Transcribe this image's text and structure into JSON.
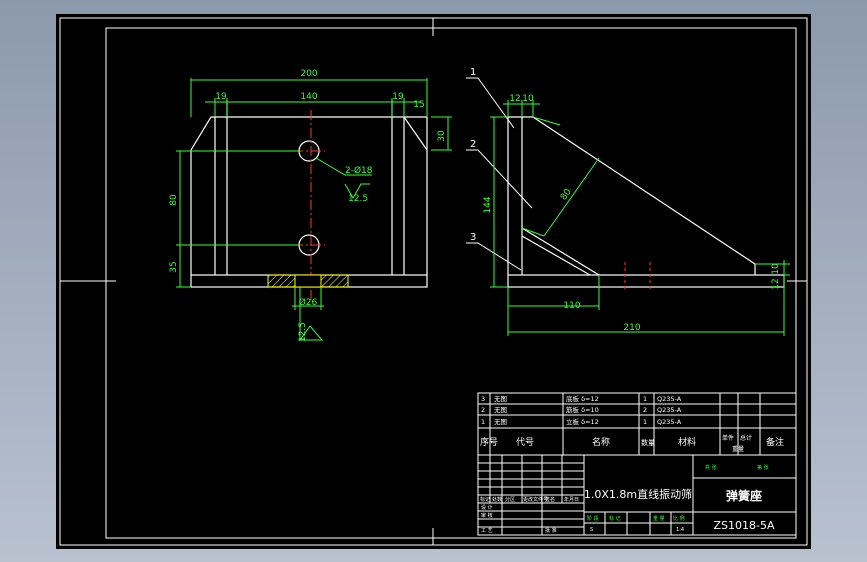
{
  "colors": {
    "background_gradient_top": "#8c99ad",
    "background_gradient_bottom": "#b9c1cf",
    "paper": "#000000",
    "frame": "#ffffff",
    "dimension": "#33ff33",
    "centerline": "#ff3333",
    "hatch": "#ffff00",
    "table_text": "#ffffff",
    "table_highlight": "#33ff33"
  },
  "front_view": {
    "dims": {
      "overall_width": "200",
      "left_flange": "19",
      "middle_span": "140",
      "right_flange": "19",
      "chamfer": "15",
      "top_height": "30",
      "hole_spacing": "80",
      "bottom_height": "35",
      "hole_callout": "2-Ø18",
      "roughness": "12.5",
      "bore": "Ø26",
      "bottom_roughness": "12.5"
    }
  },
  "side_view": {
    "balloons": [
      "1",
      "2",
      "3"
    ],
    "dims": {
      "top_a": "12",
      "top_b": "10",
      "height": "144",
      "rib_width": "80",
      "base_length": "110",
      "total_length": "210",
      "right_a": "12",
      "right_b": "10"
    }
  },
  "title_block": {
    "parts": [
      {
        "no": "3",
        "code": "无图",
        "name": "底板 δ=12",
        "qty": "1",
        "material": "Q235-A"
      },
      {
        "no": "2",
        "code": "无图",
        "name": "筋板 δ=10",
        "qty": "2",
        "material": "Q235-A"
      },
      {
        "no": "1",
        "code": "无图",
        "name": "立板 δ=12",
        "qty": "1",
        "material": "Q235-A"
      }
    ],
    "header": {
      "seq": "序号",
      "code": "代号",
      "name": "名称",
      "qty": "数量",
      "material": "材料",
      "unit_weight": "单件",
      "total_weight": "总计",
      "weight": "重量",
      "remark": "备注"
    },
    "project": "1.0X1.8m直线振动筛",
    "drawing_name": "弹簧座",
    "drawing_no": "ZS1018-5A",
    "sheet_labels": [
      "共 张",
      "第 张"
    ],
    "stage_labels": [
      "阶 段",
      "标 记",
      "重 量",
      "比 例"
    ],
    "stage_values": [
      "S",
      "1:4"
    ],
    "sign_rows": [
      "标记",
      "处数",
      "分区",
      "更改文件号",
      "签名",
      "年月日",
      "设 计",
      "审 核",
      "工 艺",
      "批 准"
    ]
  }
}
